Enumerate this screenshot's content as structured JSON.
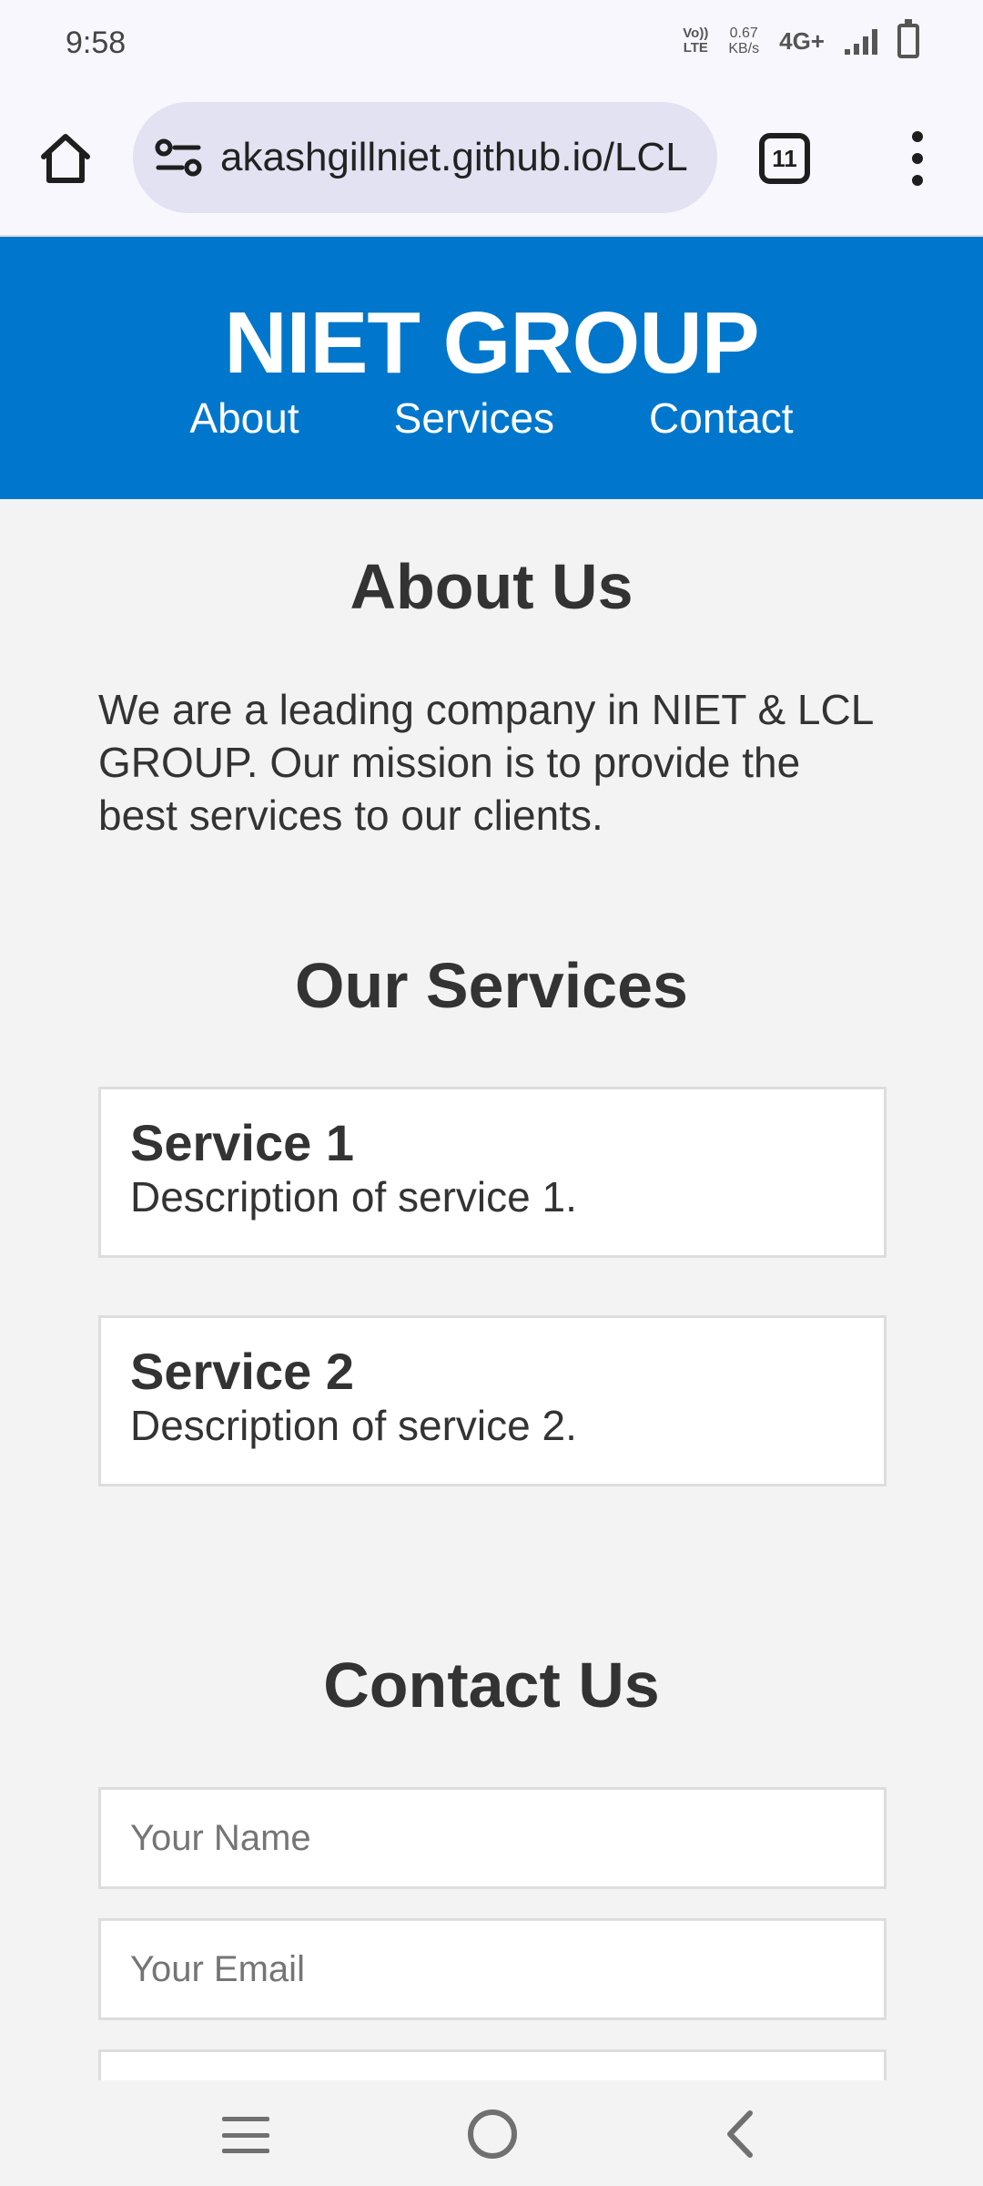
{
  "status": {
    "time": "9:58",
    "volte": [
      "Vo))",
      "LTE"
    ],
    "speed_value": "0.67",
    "speed_unit": "KB/s",
    "network": "4G+"
  },
  "browser": {
    "url": "akashgillniet.github.io/LCL",
    "tab_count": "11"
  },
  "site": {
    "title": "NIET GROUP",
    "nav": [
      "About",
      "Services",
      "Contact"
    ],
    "header_color": "#0077cc"
  },
  "about": {
    "heading": "About Us",
    "text": "We are a leading company in NIET & LCL GROUP. Our mission is to provide the best services to our clients."
  },
  "services": {
    "heading": "Our Services",
    "items": [
      {
        "name": "Service 1",
        "description": "Description of service 1."
      },
      {
        "name": "Service 2",
        "description": "Description of service 2."
      }
    ]
  },
  "contact": {
    "heading": "Contact Us",
    "name_placeholder": "Your Name",
    "email_placeholder": "Your Email"
  }
}
